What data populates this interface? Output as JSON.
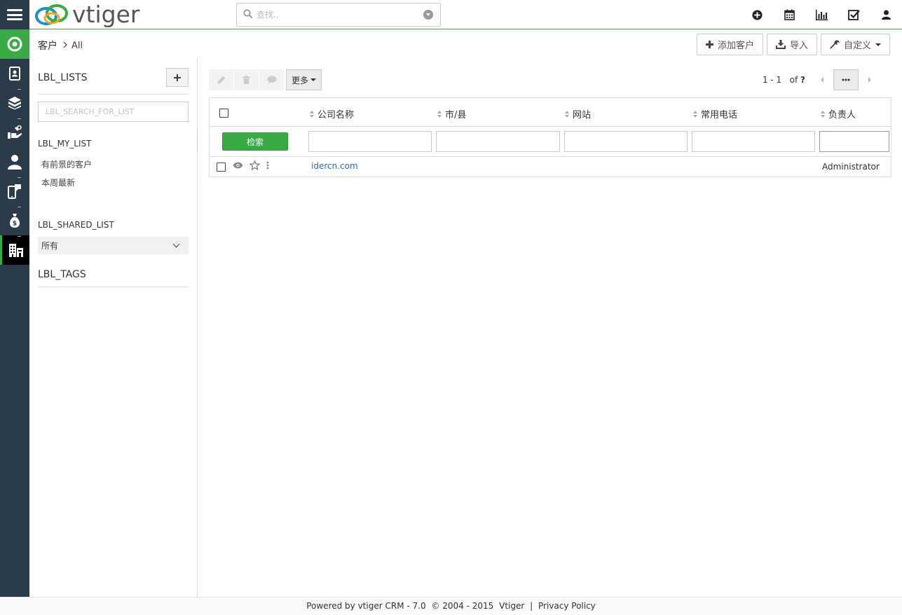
{
  "topbar": {
    "logo_text": "vtiger",
    "search_placeholder": "查找..",
    "icons": [
      "plus-circle-icon",
      "calendar-icon",
      "bar-chart-icon",
      "checkbox-icon",
      "user-icon"
    ]
  },
  "breadcrumb": {
    "module": "客户",
    "view": "All"
  },
  "header_buttons": {
    "add": "添加客户",
    "import": "导入",
    "customize": "自定义"
  },
  "list_panel": {
    "title": "LBL_LISTS",
    "search_placeholder": "LBL_SEARCH_FOR_LIST",
    "my_list_label": "LBL_MY_LIST",
    "my_lists": [
      "有前景的客户",
      "本周最新"
    ],
    "shared_list_label": "LBL_SHARED_LIST",
    "shared_selected": "所有",
    "tags_label": "LBL_TAGS"
  },
  "toolbar": {
    "more_label": "更多"
  },
  "pager": {
    "range": "1 - 1",
    "of_label": "of",
    "total": "?"
  },
  "grid": {
    "columns": [
      "公司名称",
      "市/县",
      "网站",
      "常用电话",
      "负责人"
    ],
    "search_button": "检索",
    "rows": [
      {
        "company": "idercn.com",
        "city": "",
        "website": "",
        "phone": "",
        "owner": "Administrator"
      }
    ]
  },
  "footer": {
    "powered": "Powered by vtiger CRM - 7.0",
    "copyright": "© 2004 - 2015",
    "vtiger_link": "Vtiger",
    "separator": "|",
    "privacy": "Privacy Policy"
  },
  "colors": {
    "accent": "#3aaa47",
    "sidebar": "#2c3b49",
    "link": "#2a6fb7"
  }
}
